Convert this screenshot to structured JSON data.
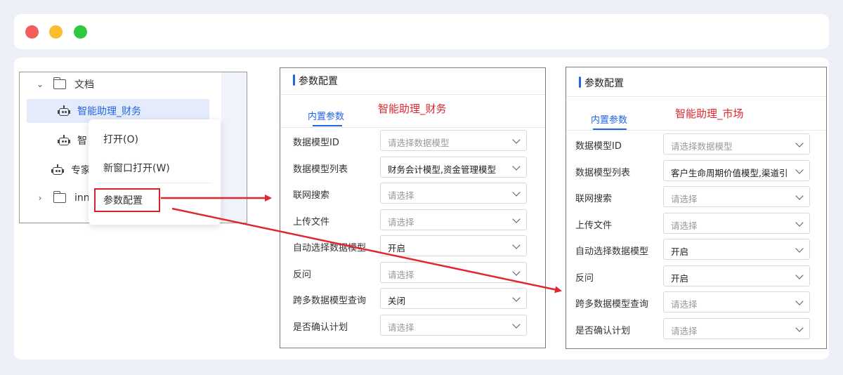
{
  "window": {
    "controls": [
      "close",
      "minimize",
      "maximize"
    ]
  },
  "tree": {
    "items": [
      {
        "label": "文档",
        "icon": "folder-icon",
        "expanded": true
      },
      {
        "label": "智能助理_财务",
        "icon": "robot-icon",
        "selected": true
      },
      {
        "label": "智",
        "icon": "robot-icon"
      },
      {
        "label": "专家",
        "icon": "robot-icon"
      },
      {
        "label": "inn",
        "icon": "folder-icon",
        "expanded": false
      }
    ]
  },
  "context_menu": {
    "items": [
      "打开(O)",
      "新窗口打开(W)",
      "参数配置"
    ]
  },
  "panel_left": {
    "title": "参数配置",
    "tab": "内置参数",
    "agent_name": "智能助理_财务",
    "fields": [
      {
        "label": "数据模型ID",
        "value": "请选择数据模型",
        "filled": false
      },
      {
        "label": "数据模型列表",
        "value": "财务会计模型,资金管理模型",
        "filled": true
      },
      {
        "label": "联网搜索",
        "value": "请选择",
        "filled": false
      },
      {
        "label": "上传文件",
        "value": "请选择",
        "filled": false
      },
      {
        "label": "自动选择数据模型",
        "value": "开启",
        "filled": true
      },
      {
        "label": "反问",
        "value": "请选择",
        "filled": false
      },
      {
        "label": "跨多数据模型查询",
        "value": "关闭",
        "filled": true
      },
      {
        "label": "是否确认计划",
        "value": "请选择",
        "filled": false
      }
    ]
  },
  "panel_right": {
    "title": "参数配置",
    "tab": "内置参数",
    "agent_name": "智能助理_市场",
    "fields": [
      {
        "label": "数据模型ID",
        "value": "请选择数据模型",
        "filled": false
      },
      {
        "label": "数据模型列表",
        "value": "客户生命周期价值模型,渠道引",
        "filled": true
      },
      {
        "label": "联网搜索",
        "value": "请选择",
        "filled": false
      },
      {
        "label": "上传文件",
        "value": "请选择",
        "filled": false
      },
      {
        "label": "自动选择数据模型",
        "value": "开启",
        "filled": true
      },
      {
        "label": "反问",
        "value": "开启",
        "filled": true
      },
      {
        "label": "跨多数据模型查询",
        "value": "请选择",
        "filled": false
      },
      {
        "label": "是否确认计划",
        "value": "请选择",
        "filled": false
      }
    ]
  },
  "colors": {
    "accent": "#2464e8",
    "annotation_red": "#e0262f",
    "selected_bg": "#e4ecfb"
  }
}
